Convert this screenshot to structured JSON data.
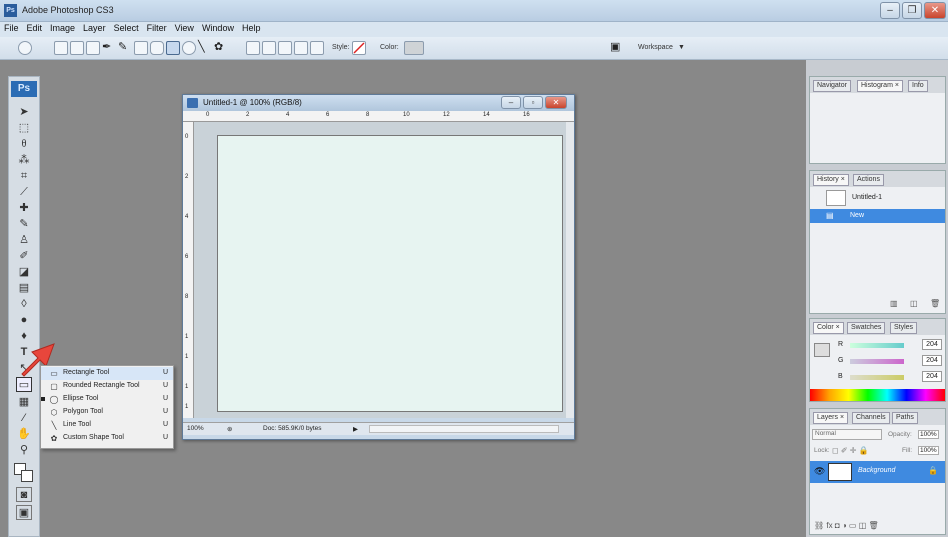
{
  "window": {
    "title": "Adobe Photoshop CS3",
    "app_icon": "Ps"
  },
  "menu": [
    "File",
    "Edit",
    "Image",
    "Layer",
    "Select",
    "Filter",
    "View",
    "Window",
    "Help"
  ],
  "options_bar": {
    "style_label": "Style:",
    "color_label": "Color:",
    "workspace_label": "Workspace"
  },
  "toolbox": {
    "logo": "Ps"
  },
  "document": {
    "title": "Untitled-1 @ 100% (RGB/8)",
    "zoom": "100%",
    "doc_info": "Doc: 585.9K/0 bytes",
    "ruler_top": [
      "0",
      "2",
      "4",
      "6",
      "8",
      "10",
      "12",
      "14",
      "16"
    ],
    "ruler_left": [
      "0",
      "2",
      "4",
      "6",
      "8",
      "1",
      "1",
      "1",
      "1"
    ]
  },
  "shape_flyout": [
    {
      "label": "Rectangle Tool",
      "key": "U",
      "icon": "rectangle-icon"
    },
    {
      "label": "Rounded Rectangle Tool",
      "key": "U",
      "icon": "rounded-rectangle-icon"
    },
    {
      "label": "Ellipse Tool",
      "key": "U",
      "icon": "ellipse-icon"
    },
    {
      "label": "Polygon Tool",
      "key": "U",
      "icon": "polygon-icon"
    },
    {
      "label": "Line Tool",
      "key": "U",
      "icon": "line-icon"
    },
    {
      "label": "Custom Shape Tool",
      "key": "U",
      "icon": "custom-shape-icon"
    }
  ],
  "panels": {
    "navigator_tabs": [
      "Navigator",
      "Histogram ×",
      "Info"
    ],
    "history_tabs": [
      "History ×",
      "Actions"
    ],
    "history_items": [
      "Untitled-1",
      "New"
    ],
    "color_tabs": [
      "Color ×",
      "Swatches",
      "Styles"
    ],
    "color": {
      "r_label": "R",
      "g_label": "G",
      "b_label": "B",
      "r": "204",
      "g": "204",
      "b": "204"
    },
    "layers_tabs": [
      "Layers ×",
      "Channels",
      "Paths"
    ],
    "blend_mode": "Normal",
    "opacity_label": "Opacity:",
    "opacity": "100%",
    "lock_label": "Lock:",
    "fill_label": "Fill:",
    "fill": "100%",
    "layer_name": "Background"
  },
  "colors": {
    "accent": "#3f8ae0",
    "canvas": "#e7f4f1",
    "workspace": "#888888"
  }
}
